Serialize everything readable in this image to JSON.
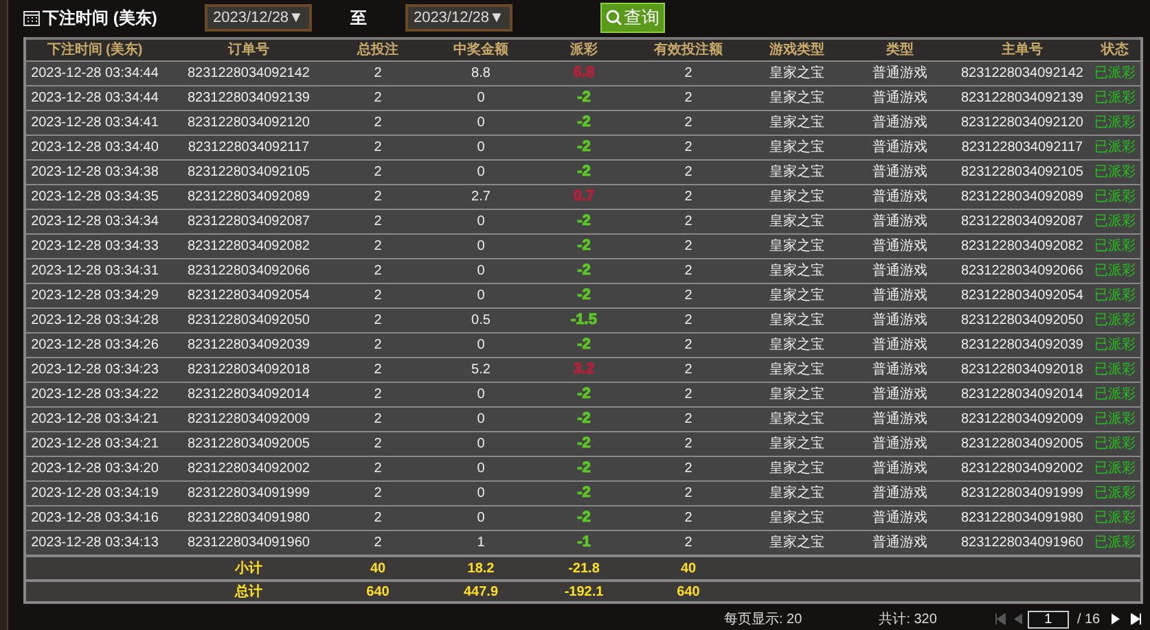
{
  "filter": {
    "label": "下注时间 (美东)",
    "from": "2023/12/28▼",
    "to_label": "至",
    "to": "2023/12/28▼",
    "query_button": "查询"
  },
  "table": {
    "columns": [
      "下注时间 (美东)",
      "订单号",
      "总投注",
      "中奖金额",
      "派彩",
      "有效投注额",
      "游戏类型",
      "类型",
      "主单号",
      "状态"
    ],
    "rows": [
      {
        "cells": [
          "2023-12-28 03:34:44",
          "8231228034092142",
          "2",
          "8.8",
          "6.8",
          "2",
          "皇家之宝",
          "普通游戏",
          "8231228034092142",
          "已派彩"
        ],
        "color": "#b3223a"
      },
      {
        "cells": [
          "2023-12-28 03:34:44",
          "8231228034092139",
          "2",
          "0",
          "-2",
          "2",
          "皇家之宝",
          "普通游戏",
          "8231228034092139",
          "已派彩"
        ],
        "color": "#5cc626"
      },
      {
        "cells": [
          "2023-12-28 03:34:41",
          "8231228034092120",
          "2",
          "0",
          "-2",
          "2",
          "皇家之宝",
          "普通游戏",
          "8231228034092120",
          "已派彩"
        ],
        "color": "#5cc626"
      },
      {
        "cells": [
          "2023-12-28 03:34:40",
          "8231228034092117",
          "2",
          "0",
          "-2",
          "2",
          "皇家之宝",
          "普通游戏",
          "8231228034092117",
          "已派彩"
        ],
        "color": "#5cc626"
      },
      {
        "cells": [
          "2023-12-28 03:34:38",
          "8231228034092105",
          "2",
          "0",
          "-2",
          "2",
          "皇家之宝",
          "普通游戏",
          "8231228034092105",
          "已派彩"
        ],
        "color": "#5cc626"
      },
      {
        "cells": [
          "2023-12-28 03:34:35",
          "8231228034092089",
          "2",
          "2.7",
          "0.7",
          "2",
          "皇家之宝",
          "普通游戏",
          "8231228034092089",
          "已派彩"
        ],
        "color": "#b3223a"
      },
      {
        "cells": [
          "2023-12-28 03:34:34",
          "8231228034092087",
          "2",
          "0",
          "-2",
          "2",
          "皇家之宝",
          "普通游戏",
          "8231228034092087",
          "已派彩"
        ],
        "color": "#5cc626"
      },
      {
        "cells": [
          "2023-12-28 03:34:33",
          "8231228034092082",
          "2",
          "0",
          "-2",
          "2",
          "皇家之宝",
          "普通游戏",
          "8231228034092082",
          "已派彩"
        ],
        "color": "#5cc626"
      },
      {
        "cells": [
          "2023-12-28 03:34:31",
          "8231228034092066",
          "2",
          "0",
          "-2",
          "2",
          "皇家之宝",
          "普通游戏",
          "8231228034092066",
          "已派彩"
        ],
        "color": "#5cc626"
      },
      {
        "cells": [
          "2023-12-28 03:34:29",
          "8231228034092054",
          "2",
          "0",
          "-2",
          "2",
          "皇家之宝",
          "普通游戏",
          "8231228034092054",
          "已派彩"
        ],
        "color": "#5cc626"
      },
      {
        "cells": [
          "2023-12-28 03:34:28",
          "8231228034092050",
          "2",
          "0.5",
          "-1.5",
          "2",
          "皇家之宝",
          "普通游戏",
          "8231228034092050",
          "已派彩"
        ],
        "color": "#5cc626"
      },
      {
        "cells": [
          "2023-12-28 03:34:26",
          "8231228034092039",
          "2",
          "0",
          "-2",
          "2",
          "皇家之宝",
          "普通游戏",
          "8231228034092039",
          "已派彩"
        ],
        "color": "#5cc626"
      },
      {
        "cells": [
          "2023-12-28 03:34:23",
          "8231228034092018",
          "2",
          "5.2",
          "3.2",
          "2",
          "皇家之宝",
          "普通游戏",
          "8231228034092018",
          "已派彩"
        ],
        "color": "#b3223a"
      },
      {
        "cells": [
          "2023-12-28 03:34:22",
          "8231228034092014",
          "2",
          "0",
          "-2",
          "2",
          "皇家之宝",
          "普通游戏",
          "8231228034092014",
          "已派彩"
        ],
        "color": "#5cc626"
      },
      {
        "cells": [
          "2023-12-28 03:34:21",
          "8231228034092009",
          "2",
          "0",
          "-2",
          "2",
          "皇家之宝",
          "普通游戏",
          "8231228034092009",
          "已派彩"
        ],
        "color": "#5cc626"
      },
      {
        "cells": [
          "2023-12-28 03:34:21",
          "8231228034092005",
          "2",
          "0",
          "-2",
          "2",
          "皇家之宝",
          "普通游戏",
          "8231228034092005",
          "已派彩"
        ],
        "color": "#5cc626"
      },
      {
        "cells": [
          "2023-12-28 03:34:20",
          "8231228034092002",
          "2",
          "0",
          "-2",
          "2",
          "皇家之宝",
          "普通游戏",
          "8231228034092002",
          "已派彩"
        ],
        "color": "#5cc626"
      },
      {
        "cells": [
          "2023-12-28 03:34:19",
          "8231228034091999",
          "2",
          "0",
          "-2",
          "2",
          "皇家之宝",
          "普通游戏",
          "8231228034091999",
          "已派彩"
        ],
        "color": "#5cc626"
      },
      {
        "cells": [
          "2023-12-28 03:34:16",
          "8231228034091980",
          "2",
          "0",
          "-2",
          "2",
          "皇家之宝",
          "普通游戏",
          "8231228034091980",
          "已派彩"
        ],
        "color": "#5cc626"
      },
      {
        "cells": [
          "2023-12-28 03:34:13",
          "8231228034091960",
          "2",
          "1",
          "-1",
          "2",
          "皇家之宝",
          "普通游戏",
          "8231228034091960",
          "已派彩"
        ],
        "color": "#5cc626"
      }
    ],
    "totals": [
      {
        "cells": [
          "小计",
          "40",
          "18.2",
          "-21.8",
          "40"
        ]
      },
      {
        "cells": [
          "总计",
          "640",
          "447.9",
          "-192.1",
          "640"
        ]
      }
    ]
  },
  "footer": {
    "per_page": "每页显示: 20",
    "total": "共计: 320",
    "page": "1",
    "pages": "/ 16"
  }
}
